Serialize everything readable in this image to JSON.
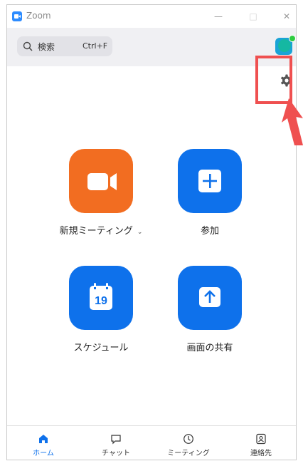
{
  "window": {
    "title": "Zoom",
    "controls": {
      "minimize": "—",
      "maximize": "□",
      "close": "✕"
    }
  },
  "search": {
    "label": "検索",
    "shortcut": "Ctrl+F"
  },
  "actions": [
    {
      "label": "新規ミーティング",
      "icon": "video-camera-icon",
      "color": "#f26d21"
    },
    {
      "label": "参加",
      "icon": "plus-icon",
      "color": "#0e71eb"
    },
    {
      "label": "スケジュール",
      "icon": "calendar-icon",
      "color": "#0e71eb",
      "icon_text": "19"
    },
    {
      "label": "画面の共有",
      "icon": "share-up-arrow-icon",
      "color": "#0e71eb"
    }
  ],
  "new_meeting_dropdown": "⌄",
  "nav": [
    {
      "label": "ホーム",
      "icon": "home-icon",
      "active": true
    },
    {
      "label": "チャット",
      "icon": "chat-icon",
      "active": false
    },
    {
      "label": "ミーティング",
      "icon": "clock-icon",
      "active": false
    },
    {
      "label": "連絡先",
      "icon": "contacts-icon",
      "active": false
    }
  ],
  "colors": {
    "accent": "#0e71eb",
    "orange": "#f26d21",
    "highlight": "#ef5050",
    "online": "#2ecc40"
  }
}
